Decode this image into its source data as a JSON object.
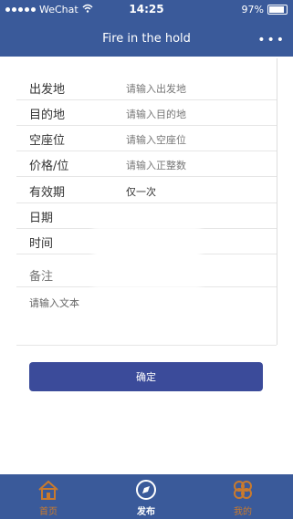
{
  "status": {
    "carrier": "WeChat",
    "time": "14:25",
    "battery": "97%"
  },
  "nav": {
    "title": "Fire in the hold",
    "more": "•••"
  },
  "form": {
    "rows": [
      {
        "label": "出发地",
        "placeholder": "请输入出发地"
      },
      {
        "label": "目的地",
        "placeholder": "请输入目的地"
      },
      {
        "label": "空座位",
        "placeholder": "请输入空座位"
      },
      {
        "label": "价格/位",
        "placeholder": "请输入正整数"
      },
      {
        "label": "有效期",
        "value": "仅一次"
      },
      {
        "label": "日期",
        "value": ""
      },
      {
        "label": "时间",
        "value": ""
      },
      {
        "label": "备注",
        "value": ""
      }
    ],
    "textarea_placeholder": "请输入文本"
  },
  "confirm_label": "确定",
  "tabs": [
    {
      "label": "首页",
      "icon": "home-icon",
      "active": false
    },
    {
      "label": "发布",
      "icon": "compass-icon",
      "active": true
    },
    {
      "label": "我的",
      "icon": "clover-icon",
      "active": false
    }
  ],
  "colors": {
    "bar": "#3a5a9a",
    "button": "#3b4b9a",
    "inactive_tab": "#c97a2d"
  }
}
